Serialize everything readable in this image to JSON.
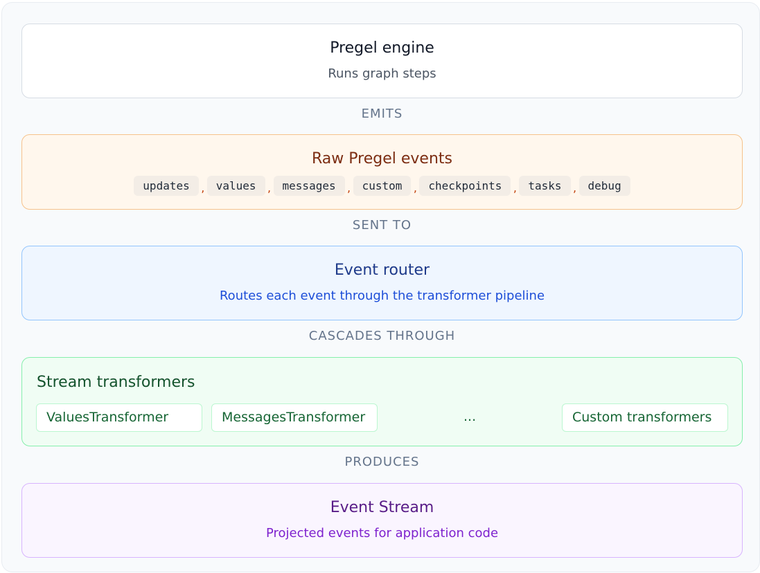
{
  "engine": {
    "title": "Pregel engine",
    "subtitle": "Runs graph steps"
  },
  "connectors": {
    "emits": "EMITS",
    "sent_to": "SENT TO",
    "cascades": "CASCADES THROUGH",
    "produces": "PRODUCES"
  },
  "raw_events": {
    "title": "Raw Pregel events",
    "types": [
      "updates",
      "values",
      "messages",
      "custom",
      "checkpoints",
      "tasks",
      "debug"
    ],
    "separator": ","
  },
  "router": {
    "title": "Event router",
    "subtitle": "Routes each event through the transformer pipeline"
  },
  "transformers": {
    "title": "Stream transformers",
    "items": [
      "ValuesTransformer",
      "MessagesTransformer",
      "Custom transformers"
    ],
    "ellipsis": "..."
  },
  "stream": {
    "title": "Event Stream",
    "subtitle": "Projected events for application code"
  },
  "colors": {
    "raw_accent": "#c2410c",
    "router_accent": "#1d4ed8",
    "transformer_accent": "#166534",
    "stream_accent": "#7e22ce"
  }
}
